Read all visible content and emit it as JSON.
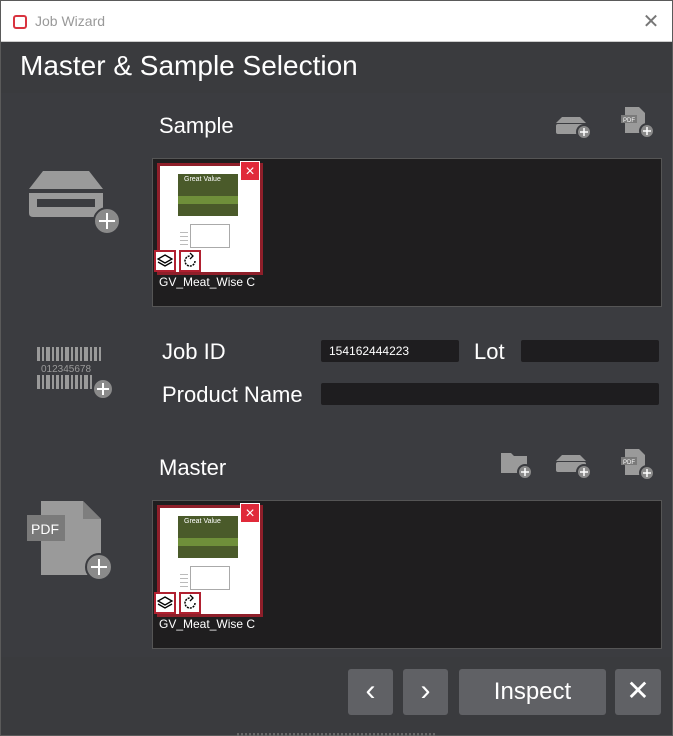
{
  "window": {
    "title": "Job Wizard",
    "close_glyph": "✕"
  },
  "page": {
    "title": "Master & Sample Selection"
  },
  "sample": {
    "label": "Sample",
    "side_icon": "scanner-add-icon",
    "actions": [
      "scan-add-icon",
      "pdf-add-icon"
    ],
    "thumbnail_caption": "GV_Meat_Wise C",
    "thumbnail_image_text": "Great Value"
  },
  "job": {
    "side_icon": "barcode-add-icon",
    "barcode_text": "012345678",
    "job_id_label": "Job ID",
    "job_id_value": "154162444223",
    "lot_label": "Lot",
    "lot_value": "",
    "product_name_label": "Product Name",
    "product_name_value": ""
  },
  "master": {
    "label": "Master",
    "side_icon": "pdf-add-icon",
    "side_icon_text": "PDF",
    "actions": [
      "folder-add-icon",
      "scan-add-icon",
      "pdf-add-icon"
    ],
    "thumbnail_caption": "GV_Meat_Wise C",
    "thumbnail_image_text": "Great Value"
  },
  "footer": {
    "prev_glyph": "‹",
    "next_glyph": "›",
    "inspect_label": "Inspect",
    "cancel_glyph": "✕"
  },
  "colors": {
    "accent_red": "#e02a3a",
    "panel": "#3b3c40",
    "field": "#1e1d1f"
  }
}
